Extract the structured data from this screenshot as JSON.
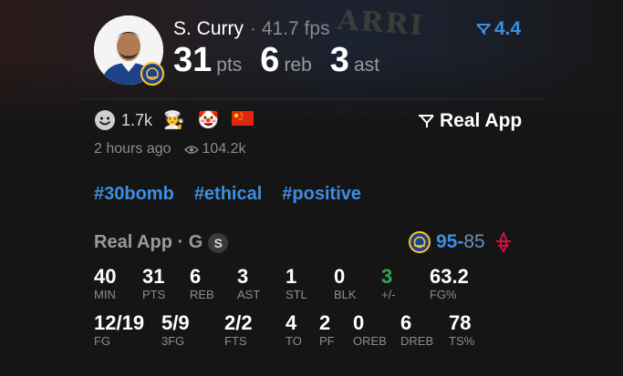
{
  "header": {
    "player_name": "S. Curry",
    "separator": "·",
    "fps": "41.7 fps",
    "rating": "4.4",
    "stats": [
      {
        "value": "31",
        "unit": "pts"
      },
      {
        "value": "6",
        "unit": "reb"
      },
      {
        "value": "3",
        "unit": "ast"
      }
    ]
  },
  "post": {
    "reaction_count": "1.7k",
    "emojis": [
      "🧑‍🍳",
      "🤡",
      "🇨🇳"
    ],
    "source_label": "Real App",
    "time_ago": "2 hours ago",
    "views": "104.2k",
    "tags": [
      "#30bomb",
      "#ethical",
      "#positive"
    ]
  },
  "game": {
    "title": "Real App · G",
    "status_badge": "S",
    "home_score": "95",
    "score_separator": "-",
    "away_score": "85",
    "colors": {
      "accent": "#3d8fe0",
      "positive": "#3aa352"
    }
  },
  "boxscore": {
    "row1": [
      {
        "value": "40",
        "label": "MIN"
      },
      {
        "value": "31",
        "label": "PTS"
      },
      {
        "value": "6",
        "label": "REB"
      },
      {
        "value": "3",
        "label": "AST"
      },
      {
        "value": "1",
        "label": "STL"
      },
      {
        "value": "0",
        "label": "BLK"
      },
      {
        "value": "3",
        "label": "+/-"
      },
      {
        "value": "63.2",
        "label": "FG%"
      }
    ],
    "row2": [
      {
        "value": "12/19",
        "label": "FG"
      },
      {
        "value": "5/9",
        "label": "3FG"
      },
      {
        "value": "2/2",
        "label": "FTS"
      },
      {
        "value": "4",
        "label": "TO"
      },
      {
        "value": "2",
        "label": "PF"
      },
      {
        "value": "0",
        "label": "OREB"
      },
      {
        "value": "6",
        "label": "DREB"
      },
      {
        "value": "78",
        "label": "TS%"
      }
    ]
  }
}
